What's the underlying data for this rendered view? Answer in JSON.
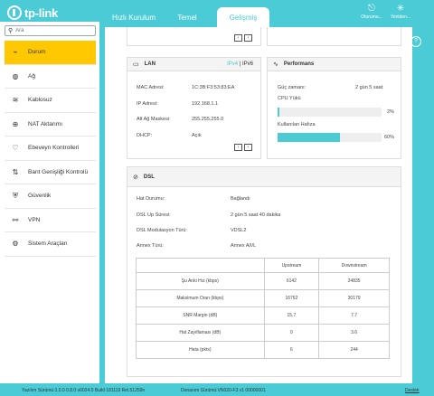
{
  "brand": "tp-link",
  "header": {
    "tabs": [
      "Hızlı Kurulum",
      "Temel",
      "Gelişmiş"
    ],
    "logout_label": "Oturumu...",
    "reboot_label": "Yeniden..."
  },
  "sidebar": {
    "search_placeholder": "Ara",
    "items": [
      {
        "label": "Durum",
        "icon": "status-icon"
      },
      {
        "label": "Ağ",
        "icon": "globe-icon"
      },
      {
        "label": "Kablosuz",
        "icon": "wireless-icon"
      },
      {
        "label": "NAT Aktarımı",
        "icon": "nat-icon"
      },
      {
        "label": "Ebeveyn Kontrolleri",
        "icon": "heart-icon"
      },
      {
        "label": "Bant Genişliği Kontrolü",
        "icon": "bandwidth-icon"
      },
      {
        "label": "Güvenlik",
        "icon": "shield-icon"
      },
      {
        "label": "VPN",
        "icon": "vpn-icon"
      },
      {
        "label": "Sistem Araçları",
        "icon": "gear-icon"
      }
    ]
  },
  "lan": {
    "title": "LAN",
    "ipv4": "IPv4",
    "sep": "|",
    "ipv6": "IPv6",
    "rows": [
      {
        "label": "MAC Adresi:",
        "value": "1C:3B:F3:53:83:EA"
      },
      {
        "label": "IP Adresi:",
        "value": "192.168.1.1"
      },
      {
        "label": "Alt Ağ Maskesi:",
        "value": "255.255.255.0"
      },
      {
        "label": "DHCP:",
        "value": "Açık"
      }
    ]
  },
  "performance": {
    "title": "Performans",
    "uptime_label": "Güç zamanı:",
    "uptime_value": "2 gün 5 saat",
    "cpu_label": "CPU Yükü",
    "cpu_percent_label": "2%",
    "cpu_value": 2,
    "mem_label": "Kullanılan Hafıza",
    "mem_percent_label": "60%",
    "mem_value": 60
  },
  "dsl": {
    "title": "DSL",
    "rows": [
      {
        "label": "Hat Durumu:",
        "value": "Bağlandı"
      },
      {
        "label": "DSL Up Süresi:",
        "value": "2 gün 5 saat 40 dakika"
      },
      {
        "label": "DSL Modulasyon Türü:",
        "value": "VDSL2"
      },
      {
        "label": "Annex Türü:",
        "value": "Annex A/I/L"
      }
    ],
    "table": {
      "headers": [
        "",
        "Upstream",
        "Downstream"
      ],
      "rows": [
        [
          "Şu Anki Hız (kbps)",
          "6142",
          "24835"
        ],
        [
          "Maksimum Oran (kbps)",
          "16762",
          "30179"
        ],
        [
          "SNR Margin (dB)",
          "15.7",
          "7.7"
        ],
        [
          "Hat Zayıflaması (dB)",
          "0",
          "3.6"
        ],
        [
          "Hata (pkts)",
          "6",
          "244"
        ]
      ]
    }
  },
  "footer": {
    "firmware": "Yazılım Sürümü:1.0.0 0.8.0 v6024.0 Build 181119 Rel.51259n",
    "hardware": "Donanım Sürümü:VN020-F3 v1 00000001",
    "support": "Destek"
  }
}
